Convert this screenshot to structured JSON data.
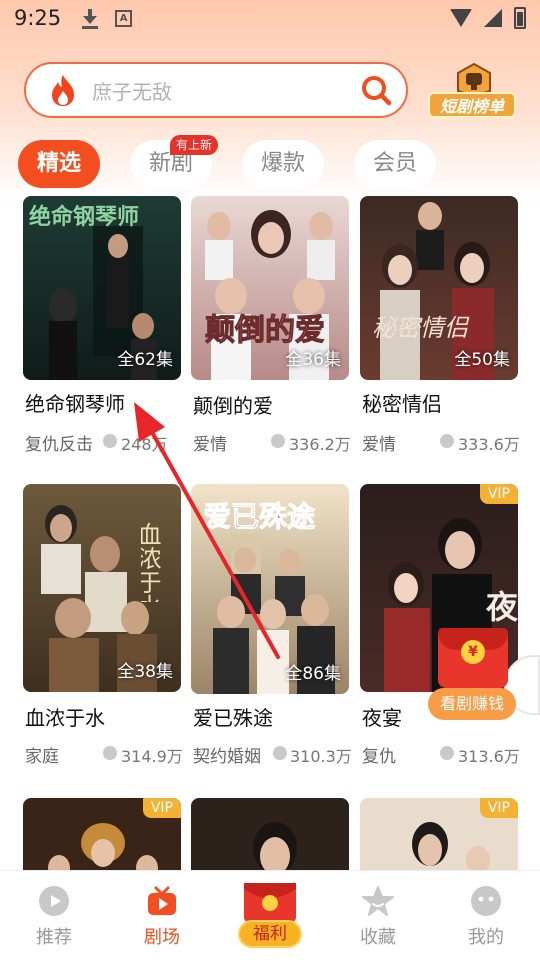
{
  "status_bar": {
    "time": "9:25"
  },
  "search": {
    "placeholder": "庶子无敌"
  },
  "rank_badge": {
    "label": "短剧榜单"
  },
  "tabs": [
    {
      "label": "精选",
      "active": true
    },
    {
      "label": "新剧",
      "badge": "有上新"
    },
    {
      "label": "爆款"
    },
    {
      "label": "会员"
    }
  ],
  "dramas": [
    {
      "title": "绝命钢琴师",
      "episodes": "全62集",
      "genre": "复仇反击",
      "views": "248万",
      "vip": false,
      "poster_text": "绝命钢琴师"
    },
    {
      "title": "颠倒的爱",
      "episodes": "全36集",
      "genre": "爱情",
      "views": "336.2万",
      "vip": false,
      "poster_text": "颠倒的爱"
    },
    {
      "title": "秘密情侣",
      "episodes": "全50集",
      "genre": "爱情",
      "views": "333.6万",
      "vip": false,
      "poster_text": "秘密情侣"
    },
    {
      "title": "血浓于水",
      "episodes": "全38集",
      "genre": "家庭",
      "views": "314.9万",
      "vip": false,
      "poster_text": "血浓于水"
    },
    {
      "title": "爱已殊途",
      "episodes": "全86集",
      "genre": "契约婚姻",
      "views": "310.3万",
      "vip": false,
      "poster_text": "爱已殊途"
    },
    {
      "title": "夜宴",
      "episodes": "",
      "genre": "复仇",
      "views": "313.6万",
      "vip": true,
      "vip_label": "VIP",
      "poster_text": "夜"
    },
    {
      "title": "",
      "episodes": "",
      "genre": "",
      "views": "",
      "vip": true,
      "vip_label": "VIP",
      "poster_text": ""
    },
    {
      "title": "",
      "episodes": "",
      "genre": "",
      "views": "",
      "vip": false,
      "poster_text": ""
    },
    {
      "title": "",
      "episodes": "",
      "genre": "",
      "views": "",
      "vip": true,
      "vip_label": "VIP",
      "poster_text": ""
    }
  ],
  "floating_reward": {
    "coin": "¥",
    "label": "看剧赚钱"
  },
  "bottom_nav": [
    {
      "label": "推荐",
      "icon": "play-circle-icon",
      "active": false
    },
    {
      "label": "剧场",
      "icon": "tv-icon",
      "active": true
    },
    {
      "label": "福利",
      "icon": "red-envelope-icon",
      "active": false
    },
    {
      "label": "收藏",
      "icon": "star-icon",
      "active": false
    },
    {
      "label": "我的",
      "icon": "face-icon",
      "active": false
    }
  ],
  "colors": {
    "accent": "#f34e1f",
    "vip": "#f4b234",
    "arrow": "#e8262a"
  }
}
